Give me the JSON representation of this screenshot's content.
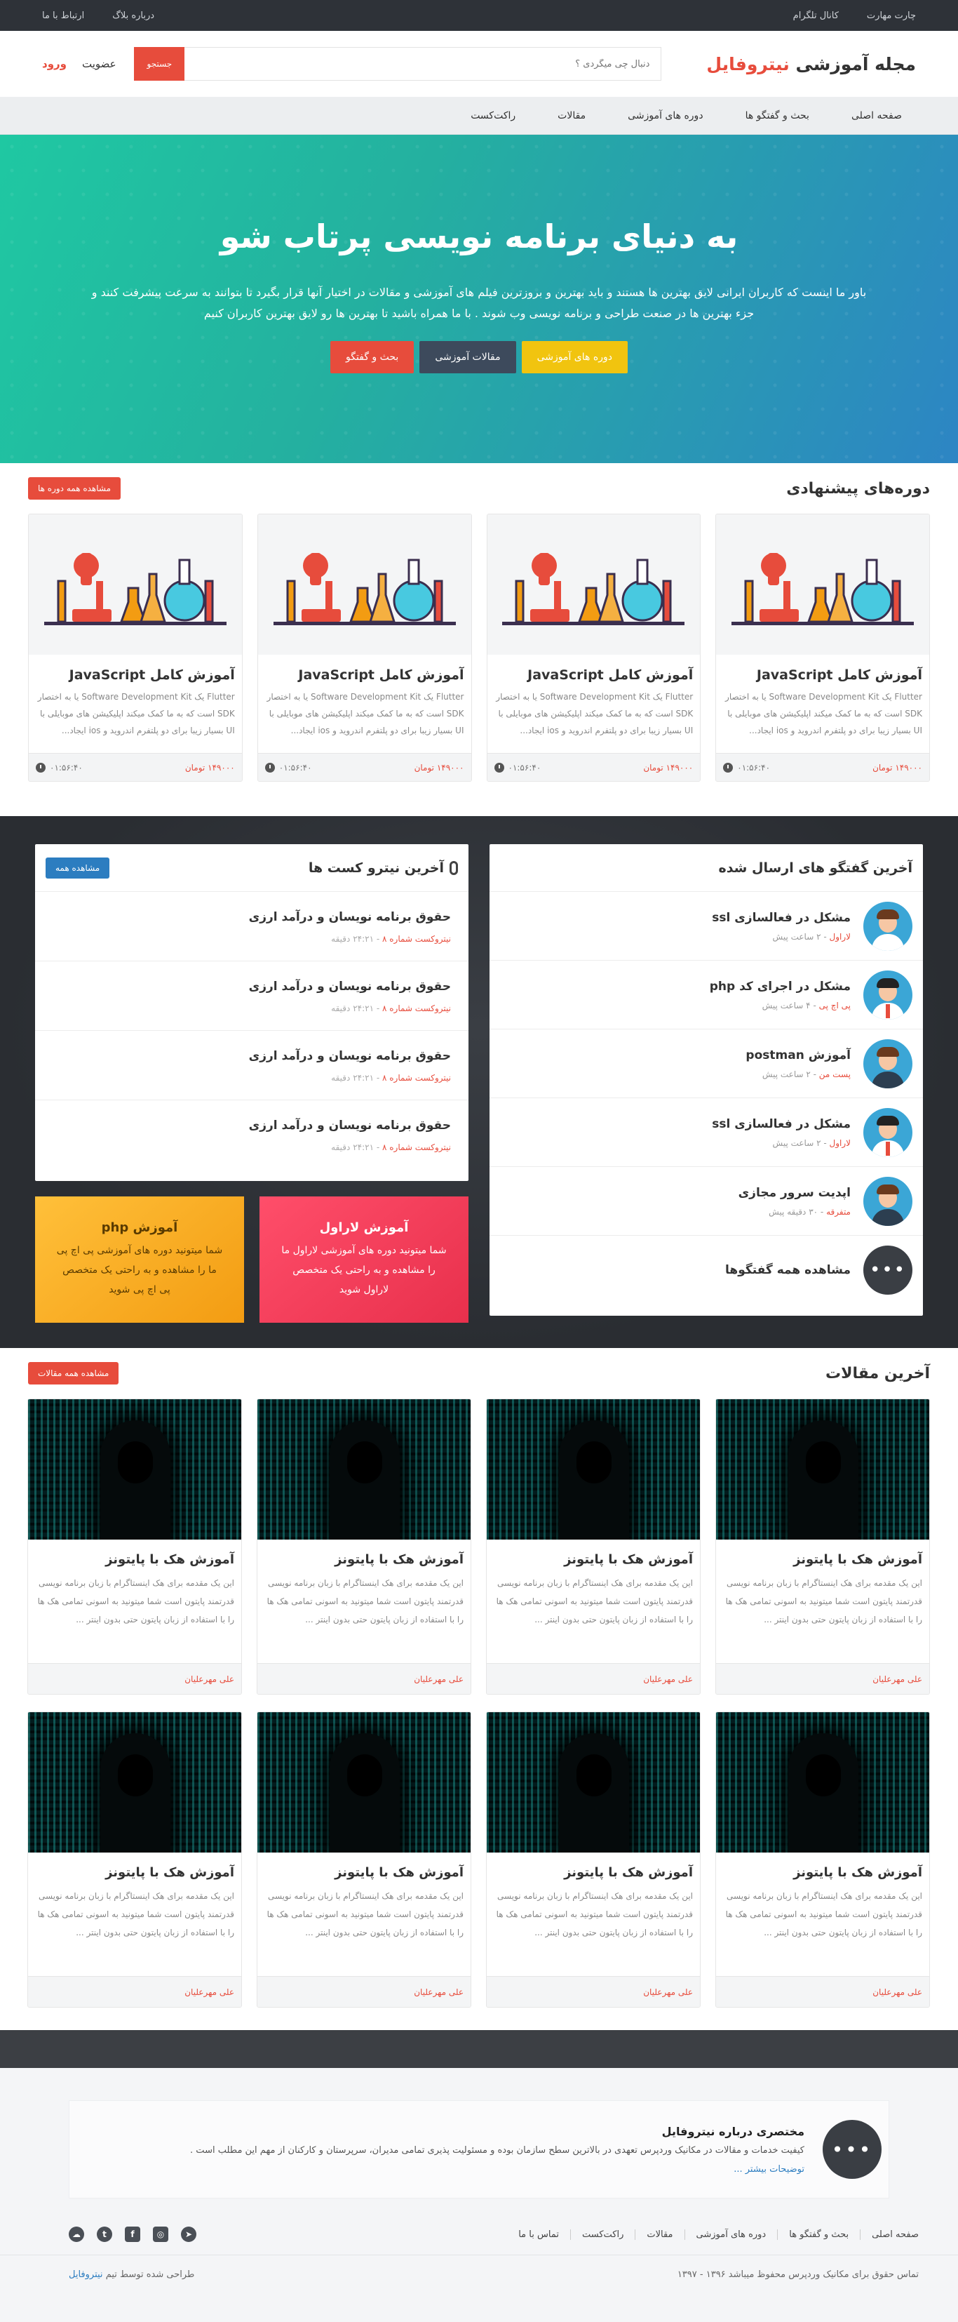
{
  "topbar": {
    "right_links": [
      "چارت مهارت",
      "کانال تلگرام"
    ],
    "left_links": [
      "درباره بلاگ",
      "ارتباط با ما"
    ]
  },
  "header": {
    "logo_prefix": "مجله آموزشی ",
    "logo_brand": "نیتروفایل",
    "search_placeholder": "دنبال چی میگردی ؟",
    "search_button": "جستجو",
    "signup": "عضویت",
    "login": "ورود"
  },
  "nav": [
    "صفحه اصلی",
    "بحث و گفتگو ها",
    "دوره های آموزشی",
    "مقالات",
    "راکت‌کست"
  ],
  "hero": {
    "title": "به دنیای برنامه نویسی پرتاب شو",
    "text": "باور ما اینست که کاربران ایرانی لایق بهترین ها هستند و باید بهترین و بروزترین فیلم های آموزشی و مقالات در اختیار آنها قرار بگیرد تا بتوانند به سرعت پیشرفت کنند و جزء بهترین ها در صنعت طراحی و برنامه نویسی وب شوند . با ما همراه باشید تا بهترین ها رو لایق بهترین کاربران کنیم",
    "btn_courses": "دوره های آموزشی",
    "btn_articles": "مقالات آموزشی",
    "btn_discuss": "بحث و گفتگو"
  },
  "courses": {
    "title": "دوره‌های پیشنهادی",
    "view_all": "مشاهده همه دوره ها",
    "items": [
      {
        "title": "آموزش کامل JavaScript",
        "desc": "Flutter یک Software Development Kit یا به اختصار SDK است که به ما کمک میکند اپلیکیشن های موبایلی با UI بسیار زیبا برای دو پلتفرم اندروید و ios ایجاد...",
        "price": "۱۴۹۰۰۰ تومان",
        "time": "۰۱:۵۶:۴۰"
      },
      {
        "title": "آموزش کامل JavaScript",
        "desc": "Flutter یک Software Development Kit یا به اختصار SDK است که به ما کمک میکند اپلیکیشن های موبایلی با UI بسیار زیبا برای دو پلتفرم اندروید و ios ایجاد...",
        "price": "۱۴۹۰۰۰ تومان",
        "time": "۰۱:۵۶:۴۰"
      },
      {
        "title": "آموزش کامل JavaScript",
        "desc": "Flutter یک Software Development Kit یا به اختصار SDK است که به ما کمک میکند اپلیکیشن های موبایلی با UI بسیار زیبا برای دو پلتفرم اندروید و ios ایجاد...",
        "price": "۱۴۹۰۰۰ تومان",
        "time": "۰۱:۵۶:۴۰"
      },
      {
        "title": "آموزش کامل JavaScript",
        "desc": "Flutter یک Software Development Kit یا به اختصار SDK است که به ما کمک میکند اپلیکیشن های موبایلی با UI بسیار زیبا برای دو پلتفرم اندروید و ios ایجاد...",
        "price": "۱۴۹۰۰۰ تومان",
        "time": "۰۱:۵۶:۴۰"
      }
    ]
  },
  "discussions": {
    "title": "آخرین گفتگو های ارسال شده",
    "items": [
      {
        "title": "مشکل در فعالسازی ssl",
        "cat": "لاراول",
        "ago": " - ۲ ساعت پیش"
      },
      {
        "title": "مشکل در اجرای کد php",
        "cat": "پی اچ پی",
        "ago": " - ۴ ساعت پیش"
      },
      {
        "title": "آموزش postman",
        "cat": "پست من",
        "ago": " - ۲ ساعت پیش"
      },
      {
        "title": "مشکل در فعالسازی ssl",
        "cat": "لاراول",
        "ago": " - ۲ ساعت پیش"
      },
      {
        "title": "اپدیت سرور مجازی",
        "cat": "متفرقه",
        "ago": " - ۳۰ دقیقه پیش"
      }
    ],
    "view_all": "مشاهده همه گفتگوها",
    "more_glyph": "•••"
  },
  "podcasts": {
    "title": "آخرین نیترو کست ها",
    "view_all": "مشاهده همه",
    "items": [
      {
        "title": "حقوق برنامه نویسان و درآمد ارزی",
        "ep": "نیتروکست شماره ۸",
        "dur": " - ۲۴:۲۱ دقیقه"
      },
      {
        "title": "حقوق برنامه نویسان و درآمد ارزی",
        "ep": "نیتروکست شماره ۸",
        "dur": " - ۲۴:۲۱ دقیقه"
      },
      {
        "title": "حقوق برنامه نویسان و درآمد ارزی",
        "ep": "نیتروکست شماره ۸",
        "dur": " - ۲۴:۲۱ دقیقه"
      },
      {
        "title": "حقوق برنامه نویسان و درآمد ارزی",
        "ep": "نیتروکست شماره ۸",
        "dur": " - ۲۴:۲۱ دقیقه"
      }
    ]
  },
  "promos": {
    "laravel_title": "آموزش لاراول",
    "laravel_text": "شما میتونید دوره های آموزشی لاراول ما را مشاهده و به راحتی یک متخصص لاراول شوید",
    "php_title": "آموزش php",
    "php_text": "شما میتونید دوره های آموزشی پی اچ پی ما را مشاهده و به راحتی یک متخصص پی اچ پی شوید"
  },
  "articles": {
    "title": "آخرین مقالات",
    "view_all": "مشاهده همه مقالات",
    "items": [
      {
        "title": "آموزش هک با پایتونز",
        "desc": "این یک مقدمه برای هک اینستاگرام با زبان برنامه نویسی قدرتمند پایتون است شما میتونید به اسونی تمامی هک ها را با استفاده از زبان پایتون حتی بدون اینتر ...",
        "author": "علی مهرعلیان"
      },
      {
        "title": "آموزش هک با پایتونز",
        "desc": "این یک مقدمه برای هک اینستاگرام با زبان برنامه نویسی قدرتمند پایتون است شما میتونید به اسونی تمامی هک ها را با استفاده از زبان پایتون حتی بدون اینتر ...",
        "author": "علی مهرعلیان"
      },
      {
        "title": "آموزش هک با پایتونز",
        "desc": "این یک مقدمه برای هک اینستاگرام با زبان برنامه نویسی قدرتمند پایتون است شما میتونید به اسونی تمامی هک ها را با استفاده از زبان پایتون حتی بدون اینتر ...",
        "author": "علی مهرعلیان"
      },
      {
        "title": "آموزش هک با پایتونز",
        "desc": "این یک مقدمه برای هک اینستاگرام با زبان برنامه نویسی قدرتمند پایتون است شما میتونید به اسونی تمامی هک ها را با استفاده از زبان پایتون حتی بدون اینتر ...",
        "author": "علی مهرعلیان"
      },
      {
        "title": "آموزش هک با پایتونز",
        "desc": "این یک مقدمه برای هک اینستاگرام با زبان برنامه نویسی قدرتمند پایتون است شما میتونید به اسونی تمامی هک ها را با استفاده از زبان پایتون حتی بدون اینتر ...",
        "author": "علی مهرعلیان"
      },
      {
        "title": "آموزش هک با پایتونز",
        "desc": "این یک مقدمه برای هک اینستاگرام با زبان برنامه نویسی قدرتمند پایتون است شما میتونید به اسونی تمامی هک ها را با استفاده از زبان پایتون حتی بدون اینتر ...",
        "author": "علی مهرعلیان"
      },
      {
        "title": "آموزش هک با پایتونز",
        "desc": "این یک مقدمه برای هک اینستاگرام با زبان برنامه نویسی قدرتمند پایتون است شما میتونید به اسونی تمامی هک ها را با استفاده از زبان پایتون حتی بدون اینتر ...",
        "author": "علی مهرعلیان"
      },
      {
        "title": "آموزش هک با پایتونز",
        "desc": "این یک مقدمه برای هک اینستاگرام با زبان برنامه نویسی قدرتمند پایتون است شما میتونید به اسونی تمامی هک ها را با استفاده از زبان پایتون حتی بدون اینتر ...",
        "author": "علی مهرعلیان"
      }
    ]
  },
  "footer": {
    "about_title": "مختصری درباره نیتروفایل",
    "about_text": "کیفیت خدمات و مقالات در مکانیک وردپرس تعهدی در بالاترین سطح سازمان بوده و مسئولیت پذیری تمامی مدیران، سرپرستان و کارکنان از مهم این مطلب است .",
    "about_more": "توضیحات بیشتر ...",
    "more_glyph": "•••",
    "links": [
      "صفحه اصلی",
      "بحث و گفتگو ها",
      "دوره های آموزشی",
      "مقالات",
      "راکت‌کست",
      "تماس با ما"
    ],
    "copyright": "تماس حقوق برای مکانیک وردپرس محفوظ میباشد ۱۳۹۶ - ۱۳۹۷",
    "credit_prefix": "طراحی شده توسط تیم ",
    "credit_brand": "نیتروفایل"
  },
  "colors": {
    "accent": "#e74c3c",
    "link": "#2c7dc0",
    "dark": "#2e3238"
  }
}
